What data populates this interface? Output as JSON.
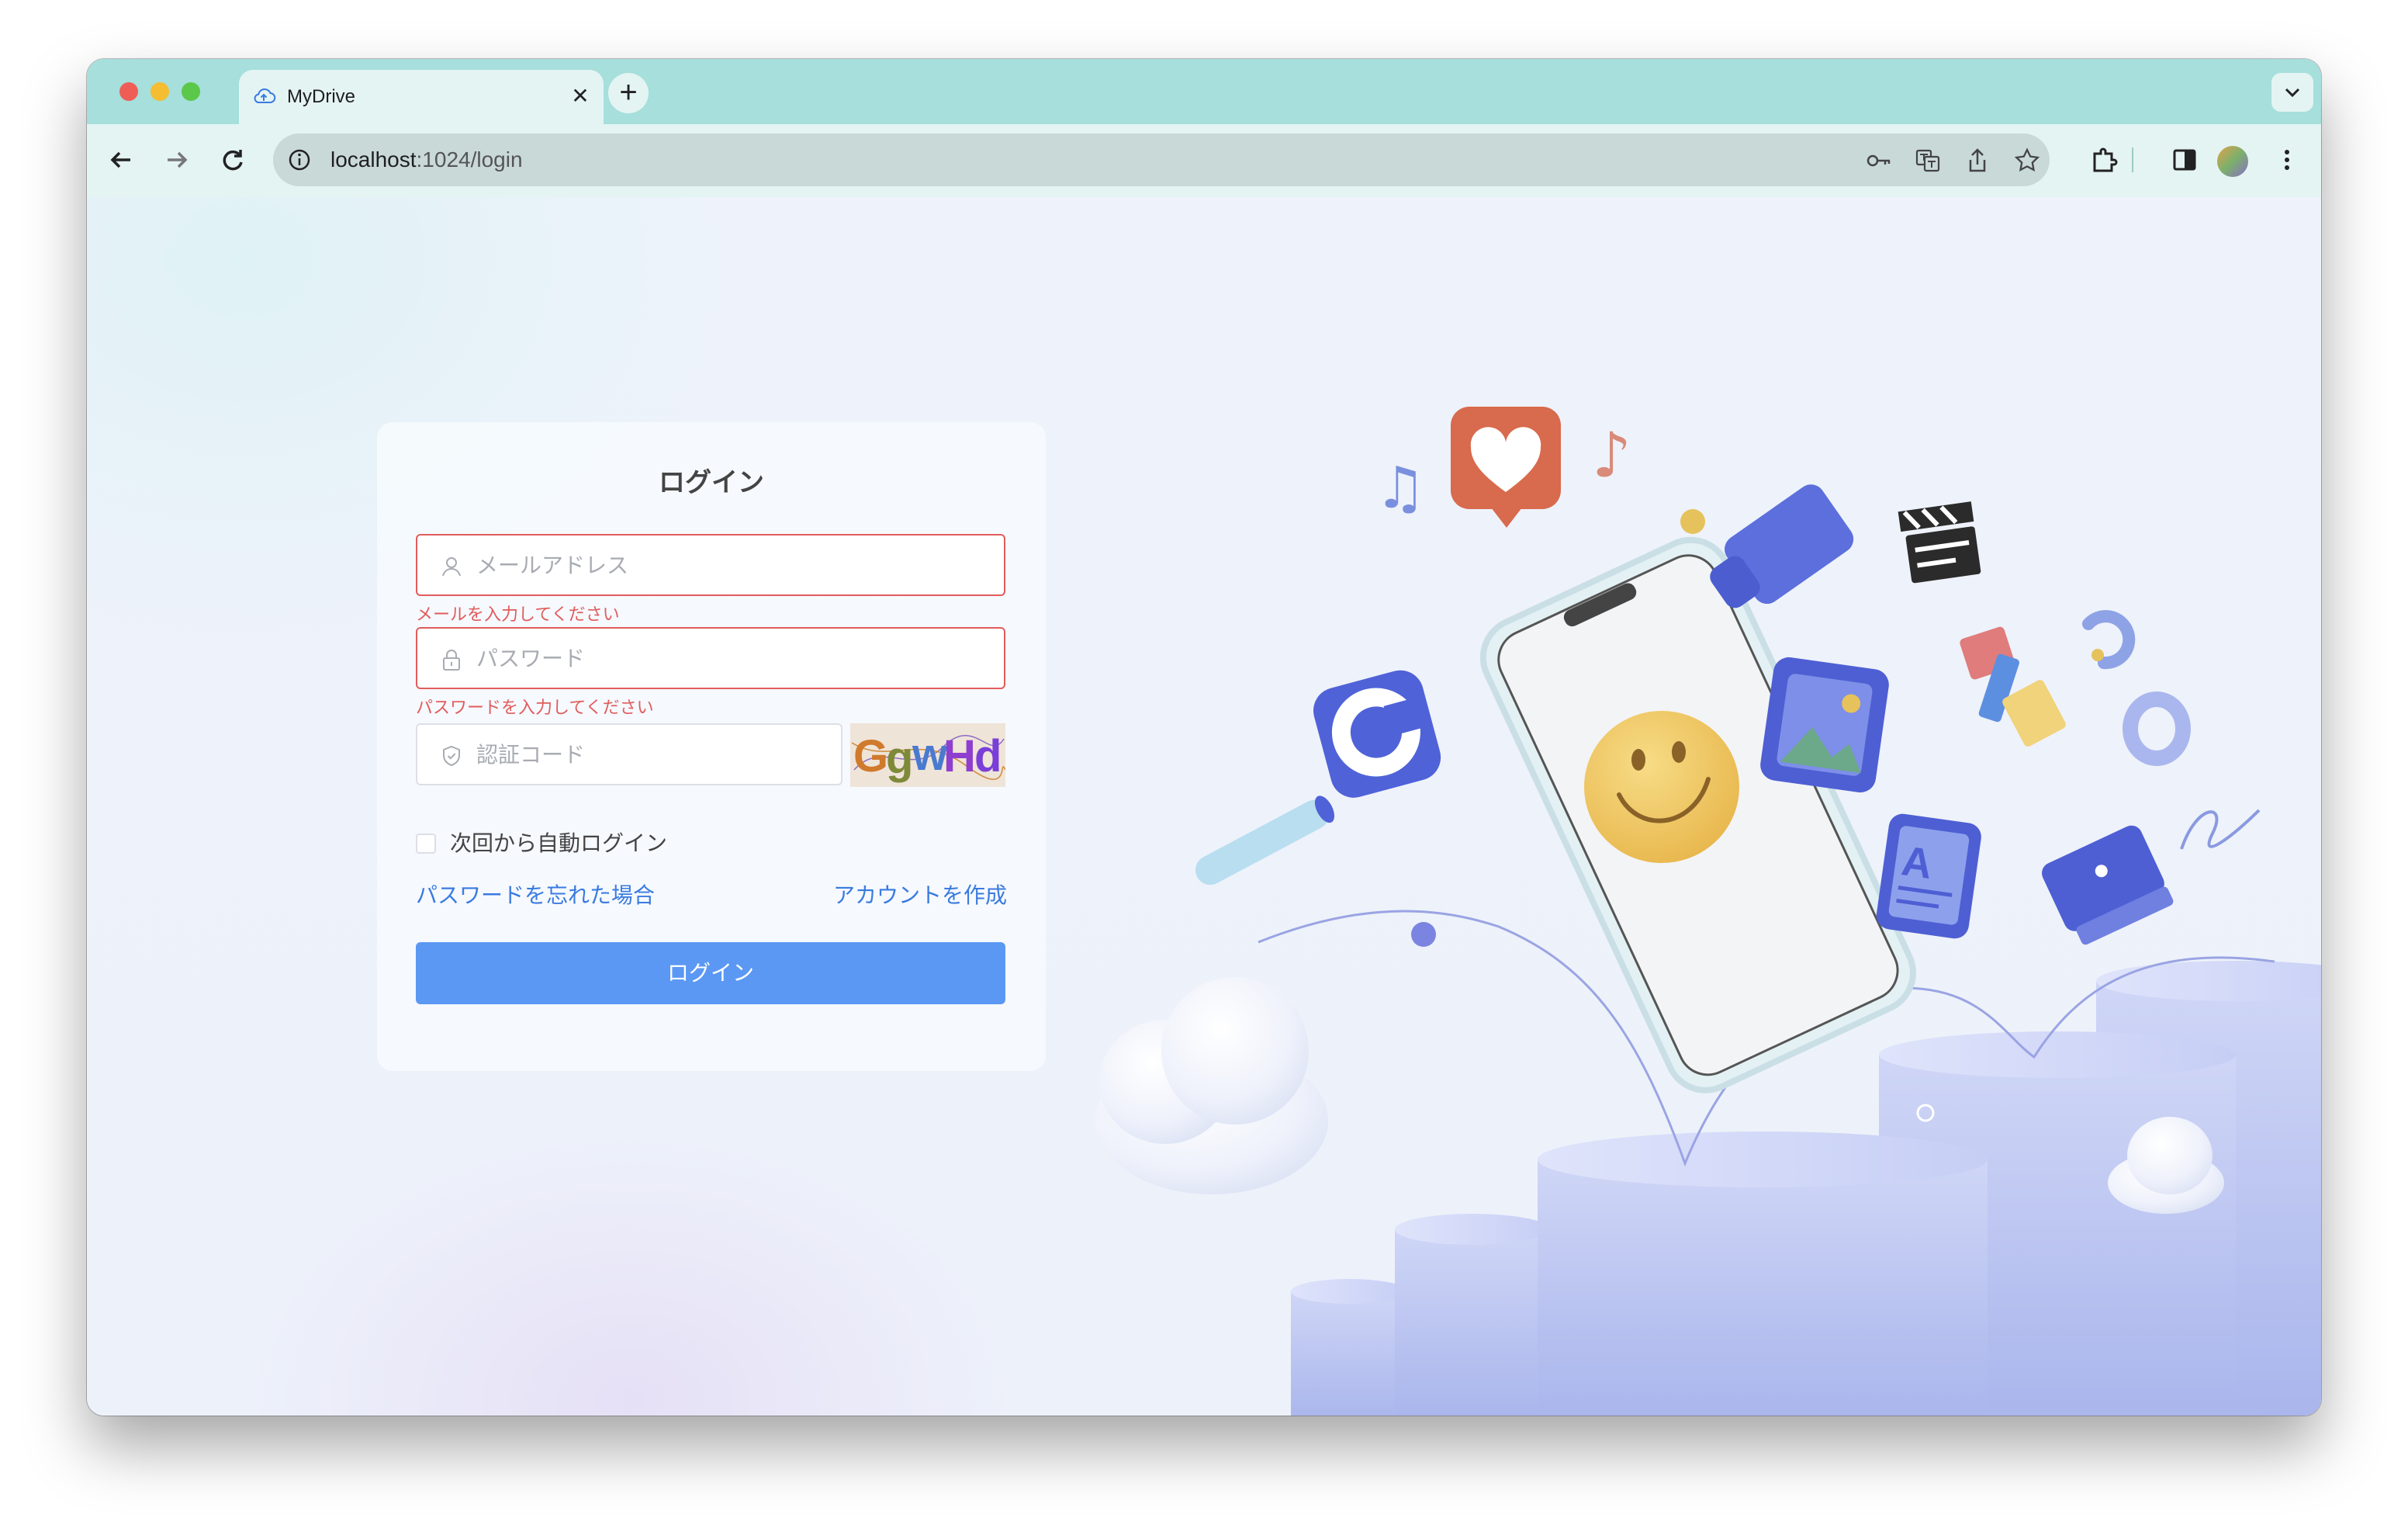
{
  "browser": {
    "tab_title": "MyDrive",
    "url_host": "localhost",
    "url_path": ":1024/login"
  },
  "login": {
    "title": "ログイン",
    "email_placeholder": "メールアドレス",
    "email_error": "メールを入力してください",
    "password_placeholder": "パスワード",
    "password_error": "パスワードを入力してください",
    "code_placeholder": "認証コード",
    "captcha_text": "GgwHd",
    "remember_label": "次回から自動ログイン",
    "forgot_link": "パスワードを忘れた場合",
    "register_link": "アカウントを作成",
    "submit_label": "ログイン"
  },
  "colors": {
    "tabbar": "#a6dfdb",
    "primary": "#5b98f4",
    "error": "#e15c5c",
    "link": "#3a7be0"
  }
}
